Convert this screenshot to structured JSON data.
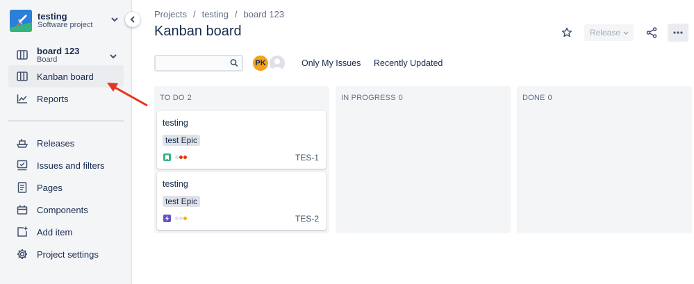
{
  "project": {
    "name": "testing",
    "type": "Software project",
    "color": "#2a7fd9"
  },
  "sidebar": {
    "board": {
      "name": "board 123",
      "type": "Board",
      "icon": "board-icon"
    },
    "items": [
      {
        "label": "Kanban board",
        "icon": "columns-icon",
        "active": true
      },
      {
        "label": "Reports",
        "icon": "chart-line-icon"
      },
      {
        "label": "Releases",
        "icon": "ship-icon"
      },
      {
        "label": "Issues and filters",
        "icon": "issues-icon"
      },
      {
        "label": "Pages",
        "icon": "page-icon"
      },
      {
        "label": "Components",
        "icon": "components-icon"
      },
      {
        "label": "Add item",
        "icon": "add-item-icon"
      },
      {
        "label": "Project settings",
        "icon": "gear-icon"
      }
    ]
  },
  "breadcrumb": [
    "Projects",
    "testing",
    "board 123"
  ],
  "page_title": "Kanban board",
  "header_actions": {
    "release_label": "Release"
  },
  "toolbar": {
    "search_value": "",
    "avatar_initials": "PK",
    "filters": [
      "Only My Issues",
      "Recently Updated"
    ]
  },
  "columns": [
    {
      "title": "TO DO",
      "count": "2",
      "cards": [
        {
          "title": "testing",
          "epic": "test Epic",
          "key": "TES-1",
          "type": "story",
          "type_color": "#36b37e",
          "priority": "high",
          "dot_colors": [
            "#dfe1e6",
            "#de350b",
            "#de350b"
          ]
        },
        {
          "title": "testing",
          "epic": "test Epic",
          "key": "TES-2",
          "type": "epic",
          "type_color": "#6554c0",
          "priority": "medium",
          "dot_colors": [
            "#dfe1e6",
            "#dfe1e6",
            "#ffab00"
          ]
        }
      ]
    },
    {
      "title": "IN PROGRESS",
      "count": "0",
      "cards": []
    },
    {
      "title": "DONE",
      "count": "0",
      "cards": []
    }
  ],
  "colors": {
    "accent": "#0052cc",
    "arrow": "#e8341c"
  }
}
